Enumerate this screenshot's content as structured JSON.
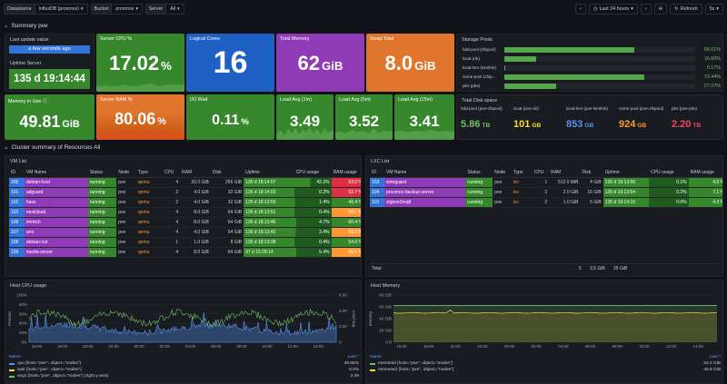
{
  "topbar": {
    "vars": [
      {
        "label": "Datasource",
        "value": "InfluxDB (proxmox)"
      },
      {
        "label": "Bucket",
        "value": "proxmox"
      },
      {
        "label": "Server",
        "value": "All"
      }
    ],
    "time_range": "Last 24 hours",
    "refresh": "Refresh",
    "refresh_interval": "5s"
  },
  "rows": {
    "summary": "Summary pve",
    "cluster": "Cluster summary of Resources All"
  },
  "stats": {
    "last_update": {
      "title": "Last update value",
      "value": "a few seconds ago"
    },
    "uptime": {
      "title": "Uptime Server",
      "value": "135 d 19:14:44"
    },
    "cpu": {
      "title": "Server CPU %",
      "value": "17.02",
      "unit": "%"
    },
    "cores": {
      "title": "Logical Cores",
      "value": "16"
    },
    "total_mem": {
      "title": "Total Memory",
      "value": "62",
      "unit": "GiB"
    },
    "swap": {
      "title": "Swap Total",
      "value": "8.0",
      "unit": "GiB"
    },
    "mem_use": {
      "title": "Memory in Use",
      "value": "49.81",
      "unit": "GiB"
    },
    "ram_pct": {
      "title": "Server RAM %",
      "value": "80.06",
      "unit": "%"
    },
    "io_wait": {
      "title": "I/O Wait",
      "value": "0.11",
      "unit": "%"
    },
    "load1": {
      "title": "Load Avg (1m)",
      "value": "3.49"
    },
    "load5": {
      "title": "Load Avg (5m)",
      "value": "3.52"
    },
    "load15": {
      "title": "Load Avg (15m)",
      "value": "3.41"
    }
  },
  "storage_pools": {
    "title": "Storage Pools",
    "items": [
      {
        "name": "hdd-pool (zfspool)",
        "value": "68.01%",
        "fraction": 0.6801
      },
      {
        "name": "local (dir)",
        "value": "16.60%",
        "fraction": 0.166
      },
      {
        "name": "local-lvm (lvmthin)",
        "value": "0.17%",
        "fraction": 0.0017
      },
      {
        "name": "nvme-pool (zfsp...",
        "value": "73.44%",
        "fraction": 0.7344
      },
      {
        "name": "pbs (pbs)",
        "value": "27.07%",
        "fraction": 0.2707
      }
    ]
  },
  "total_disk": {
    "title": "Total Disk space",
    "items": [
      {
        "name": "hdd-pool (pve-zfspool)",
        "value": "5.86",
        "unit": "TB",
        "color": "#73bf69"
      },
      {
        "name": "local (pve-dir)",
        "value": "101",
        "unit": "GB",
        "color": "#fade2a"
      },
      {
        "name": "local-lvm (pve-lvmthin)",
        "value": "853",
        "unit": "GB",
        "color": "#5794f2"
      },
      {
        "name": "nvme-pool (pve-zfspool)",
        "value": "924",
        "unit": "GB",
        "color": "#ff9830"
      },
      {
        "name": "pbs (pve-pbs)",
        "value": "2.20",
        "unit": "TB",
        "color": "#f2495c"
      }
    ]
  },
  "vm_list": {
    "title": "VM List",
    "headers": [
      "ID",
      "VM Name",
      "Status",
      "Node",
      "Type",
      "CPU",
      "RAM",
      "Disk",
      "Uptime",
      "CPU usage",
      "RAM usage"
    ],
    "rows": [
      {
        "id": "100",
        "name": "debian-host",
        "status": "running",
        "node": "pve",
        "type": "qemu",
        "cpu": "4",
        "ram": "20.0 GiB",
        "disk": "256 GiB",
        "uptime": "135 d 18:14:07",
        "cpu_usage": "42.2%",
        "ram_usage": "93.0 %",
        "cpu_frac": 0.422,
        "ram_frac": 0.93,
        "ram_color": "#e02f44"
      },
      {
        "id": "101",
        "name": "adguard",
        "status": "running",
        "node": "pve",
        "type": "qemu",
        "cpu": "2",
        "ram": "4.0 GiB",
        "disk": "32 GiB",
        "uptime": "135 d 18:14:03",
        "cpu_usage": "0.2%",
        "ram_usage": "92.7 %",
        "cpu_frac": 0.002,
        "ram_frac": 0.927,
        "ram_color": "#e02f44"
      },
      {
        "id": "102",
        "name": "hass",
        "status": "running",
        "node": "pve",
        "type": "qemu",
        "cpu": "2",
        "ram": "4.0 GiB",
        "disk": "32 GiB",
        "uptime": "135 d 18:13:59",
        "cpu_usage": "1.4%",
        "ram_usage": "46.4 %",
        "cpu_frac": 0.014,
        "ram_frac": 0.464,
        "ram_color": "#37872d"
      },
      {
        "id": "103",
        "name": "nextcloud",
        "status": "running",
        "node": "pve",
        "type": "qemu",
        "cpu": "4",
        "ram": "8.0 GiB",
        "disk": "64 GiB",
        "uptime": "135 d 18:13:51",
        "cpu_usage": "0.4%",
        "ram_usage": "84.1 %",
        "cpu_frac": 0.004,
        "ram_frac": 0.841,
        "ram_color": "#ff9830"
      },
      {
        "id": "106",
        "name": "immich",
        "status": "running",
        "node": "pve",
        "type": "qemu",
        "cpu": "4",
        "ram": "8.0 GiB",
        "disk": "64 GiB",
        "uptime": "135 d 18:13:46",
        "cpu_usage": "4.7%",
        "ram_usage": "60.4 %",
        "cpu_frac": 0.047,
        "ram_frac": 0.604,
        "ram_color": "#37872d"
      },
      {
        "id": "107",
        "name": "arrs",
        "status": "running",
        "node": "pve",
        "type": "qemu",
        "cpu": "4",
        "ram": "4.0 GiB",
        "disk": "64 GiB",
        "uptime": "135 d 18:13:42",
        "cpu_usage": "3.4%",
        "ram_usage": "89.5 %",
        "cpu_frac": 0.034,
        "ram_frac": 0.895,
        "ram_color": "#ff9830"
      },
      {
        "id": "108",
        "name": "debian-nut",
        "status": "running",
        "node": "pve",
        "type": "qemu",
        "cpu": "1",
        "ram": "1.0 GiB",
        "disk": "8 GiB",
        "uptime": "135 d 18:13:38",
        "cpu_usage": "0.4%",
        "ram_usage": "54.0 %",
        "cpu_frac": 0.004,
        "ram_frac": 0.54,
        "ram_color": "#37872d"
      },
      {
        "id": "109",
        "name": "media-server",
        "status": "running",
        "node": "pve",
        "type": "qemu",
        "cpu": "4",
        "ram": "8.0 GiB",
        "disk": "64 GiB",
        "uptime": "97 d 15:28:14",
        "cpu_usage": "5.4%",
        "ram_usage": "89.5 %",
        "cpu_frac": 0.054,
        "ram_frac": 0.895,
        "ram_color": "#ff9830"
      }
    ]
  },
  "lxc_list": {
    "title": "LXC List",
    "headers": [
      "ID",
      "VM Name",
      "Status",
      "Node",
      "Type",
      "CPU",
      "RAM",
      "Disk",
      "Uptime",
      "CPU usage",
      "RAM usage"
    ],
    "rows": [
      {
        "id": "103",
        "name": "wireguard",
        "status": "running",
        "node": "pve",
        "type": "lxc",
        "cpu": "1",
        "ram": "512.0 MiB",
        "disk": "4 GiB",
        "uptime": "135 d 19:13:56",
        "cpu_usage": "0.1%",
        "ram_usage": "4.5 %",
        "cpu_frac": 0.001,
        "ram_frac": 0.045
      },
      {
        "id": "104",
        "name": "proxmox-backup-server",
        "status": "running",
        "node": "pve",
        "type": "lxc",
        "cpu": "2",
        "ram": "2.0 GiB",
        "disk": "16 GiB",
        "uptime": "135 d 19:13:54",
        "cpu_usage": "0.2%",
        "ram_usage": "7.1 %",
        "cpu_frac": 0.002,
        "ram_frac": 0.071
      },
      {
        "id": "110",
        "name": "zigbee2mqtt",
        "status": "running",
        "node": "pve",
        "type": "lxc",
        "cpu": "2",
        "ram": "1.0 GiB",
        "disk": "5 GiB",
        "uptime": "135 d 19:14:10",
        "cpu_usage": "0.0%",
        "ram_usage": "4.3 %",
        "cpu_frac": 0.0,
        "ram_frac": 0.043
      }
    ],
    "total_label": "Total",
    "total_cpu": "5",
    "total_ram": "3.5 GiB",
    "total_disk": "25 GiB"
  },
  "host_cpu": {
    "title": "Host CPU usage",
    "y_left_label": "Percent",
    "y_right_label": "Load avg",
    "y_left_ticks": [
      "100%",
      "80%",
      "60%",
      "40%",
      "20%",
      "0%"
    ],
    "y_right_ticks": [
      "6.00",
      "4.00",
      "2.00",
      "0"
    ],
    "x_ticks": [
      "16:00",
      "18:00",
      "20:00",
      "22:00",
      "00:00",
      "02:00",
      "04:00",
      "06:00",
      "08:00",
      "10:00",
      "12:00",
      "14:00"
    ],
    "legend_name": "Name",
    "legend_last": "Last *",
    "legend": [
      {
        "name": "cpu {host=\"pve\", object=\"nodes\"}",
        "value": "29.65%",
        "color": "#5794f2"
      },
      {
        "name": "wait {host=\"pve\", object=\"nodes\"}",
        "value": "0.0%",
        "color": "#fade2a"
      },
      {
        "name": "avg1 {host=\"pve\", object=\"nodes\"} (right y-axis)",
        "value": "3.35",
        "color": "#73bf69"
      }
    ]
  },
  "host_mem": {
    "title": "Host Memory",
    "y_left_label": "Memory",
    "y_left_ticks": [
      "80 GiB",
      "60 GiB",
      "40 GiB",
      "20 GiB",
      "0 B"
    ],
    "x_ticks": [
      "16:00",
      "18:00",
      "20:00",
      "22:00",
      "00:00",
      "02:00",
      "04:00",
      "06:00",
      "08:00",
      "10:00",
      "12:00",
      "14:00"
    ],
    "legend_name": "Name",
    "legend_last": "Last *",
    "legend": [
      {
        "name": "memtotal {host=\"pve\", object=\"nodes\"}",
        "value": "62.2 GiB",
        "color": "#73bf69"
      },
      {
        "name": "memused {host=\"pve\", object=\"nodes\"}",
        "value": "49.8 GiB",
        "color": "#fade2a"
      }
    ]
  },
  "colors": {
    "green_panel": "#37872d",
    "blue_panel": "#1f60c4",
    "purple_panel": "#8f3bb8",
    "orange_panel": "#e0752d",
    "lightblue_cell": "#3274d9"
  }
}
